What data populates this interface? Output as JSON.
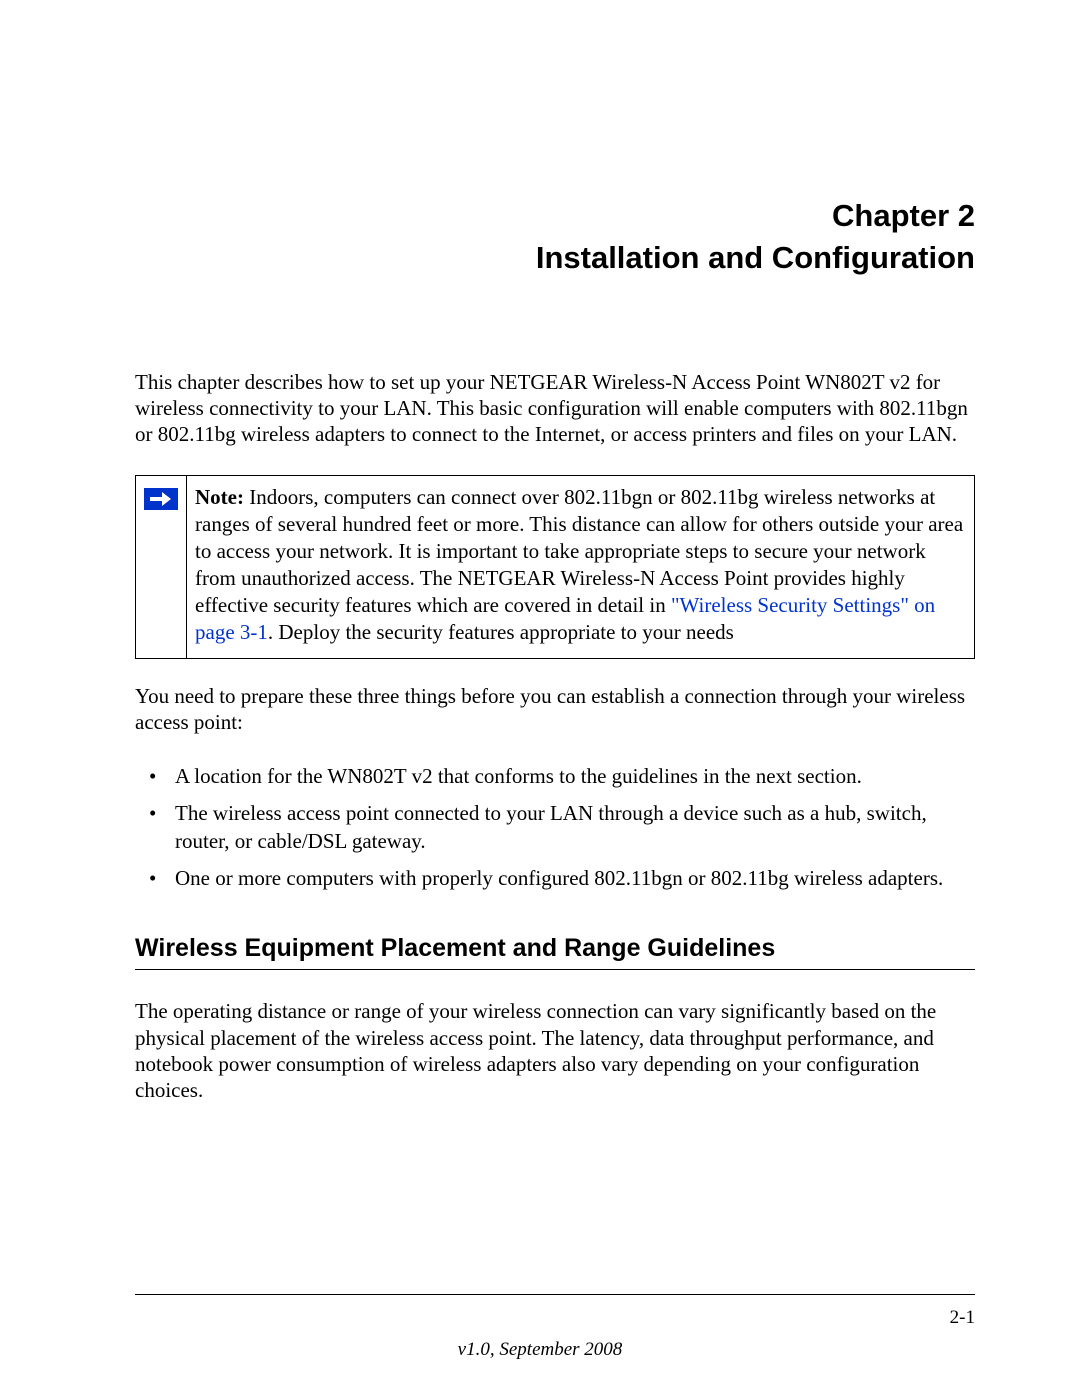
{
  "chapter": {
    "number_line": "Chapter 2",
    "title_line": "Installation and Configuration"
  },
  "intro_paragraph": "This chapter describes how to set up your NETGEAR Wireless-N Access Point WN802T v2 for wireless connectivity to your LAN. This basic configuration will enable computers with 802.11bgn or 802.11bg wireless adapters to connect to the Internet, or access printers and files on your LAN.",
  "note": {
    "label": "Note:",
    "text_before_link": " Indoors, computers can connect over 802.11bgn or 802.11bg wireless networks at ranges of several hundred feet or more. This distance can allow for others outside your area to access your network. It is important to take appropriate steps to secure your network from unauthorized access. The NETGEAR Wireless-N Access Point provides highly effective security features which are covered in detail in ",
    "link_text": "\"Wireless Security Settings\" on page 3-1",
    "text_after_link": ". Deploy the security features appropriate to your needs"
  },
  "prep_paragraph": "You need to prepare these three things before you can establish a connection through your wireless access point:",
  "bullets": [
    "A location for the WN802T v2 that conforms to the guidelines in the next section.",
    "The wireless access point connected to your LAN through a device such as a hub, switch, router, or cable/DSL gateway.",
    "One or more computers with properly configured 802.11bgn or 802.11bg wireless adapters."
  ],
  "section_heading": "Wireless Equipment Placement and Range Guidelines",
  "section_paragraph": "The operating distance or range of your wireless connection can vary significantly based on the physical placement of the wireless access point. The latency, data throughput performance, and notebook power consumption of wireless adapters also vary depending on your configuration choices.",
  "footer": {
    "page_number": "2-1",
    "version": "v1.0, September 2008"
  }
}
